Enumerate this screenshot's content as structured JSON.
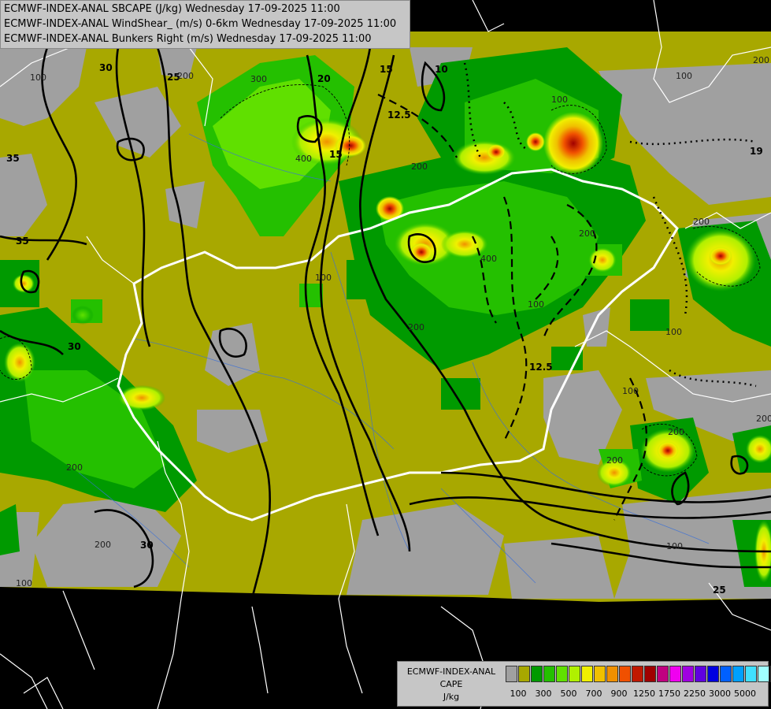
{
  "titles": [
    "ECMWF-INDEX-ANAL SBCAPE (J/kg) Wednesday 17-09-2025 11:00",
    "ECMWF-INDEX-ANAL WindShear_ (m/s) 0-6km Wednesday 17-09-2025 11:00",
    "ECMWF-INDEX-ANAL Bunkers Right (m/s) Wednesday 17-09-2025 11:00"
  ],
  "legend": {
    "line1": "ECMWF-INDEX-ANAL",
    "line2": "CAPE",
    "line3": "J/kg",
    "colors": [
      "#a0a0a0",
      "#a8a800",
      "#009a00",
      "#24c000",
      "#60e000",
      "#b0f000",
      "#f0f000",
      "#f0c000",
      "#f09000",
      "#f05000",
      "#c01800",
      "#a00000",
      "#c00080",
      "#f000f0",
      "#a000e0",
      "#6000e0",
      "#0000e0",
      "#0060ff",
      "#00a0ff",
      "#40e0ff",
      "#a0ffff",
      "#ffffff"
    ],
    "tick_labels": [
      "100",
      "300",
      "500",
      "700",
      "900",
      "1250",
      "1750",
      "2250",
      "3000",
      "5000"
    ]
  },
  "contour_labels": {
    "shear": [
      "30",
      "25",
      "20",
      "15",
      "10",
      "12.5",
      "35",
      "35",
      "30",
      "30",
      "12.5",
      "15",
      "25",
      "19"
    ],
    "cape": [
      "100",
      "200",
      "200",
      "400",
      "300",
      "200",
      "100",
      "200",
      "200",
      "400",
      "200",
      "100",
      "200",
      "100",
      "100",
      "200",
      "100",
      "200",
      "100",
      "200",
      "100",
      "200",
      "100"
    ]
  },
  "colors": {
    "background": "#000000",
    "land_gray": "#a0a0a0",
    "cape_low": "#a8a800",
    "border": "#ffffff"
  }
}
